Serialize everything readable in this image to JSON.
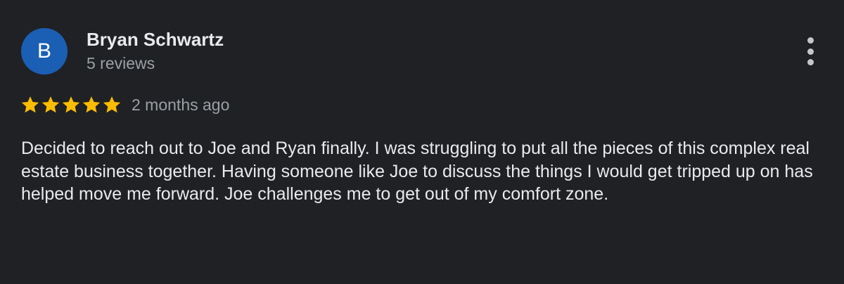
{
  "review": {
    "author": {
      "initial": "B",
      "name": "Bryan Schwartz",
      "review_count": "5 reviews",
      "avatar_color": "#1a5fb4"
    },
    "rating": {
      "value": 5,
      "max": 5,
      "star_color": "#fbbc04"
    },
    "time_ago": "2 months ago",
    "text": "Decided to reach out to Joe and Ryan finally. I was struggling to put all the pieces of this complex real estate business together. Having someone like Joe to discuss the things I would get tripped up on has helped move me forward. Joe challenges me to get out of my comfort zone.",
    "menu_icon": "more-vert-icon"
  },
  "colors": {
    "background": "#202124",
    "primary_text": "#e8eaed",
    "secondary_text": "#9aa0a6"
  }
}
